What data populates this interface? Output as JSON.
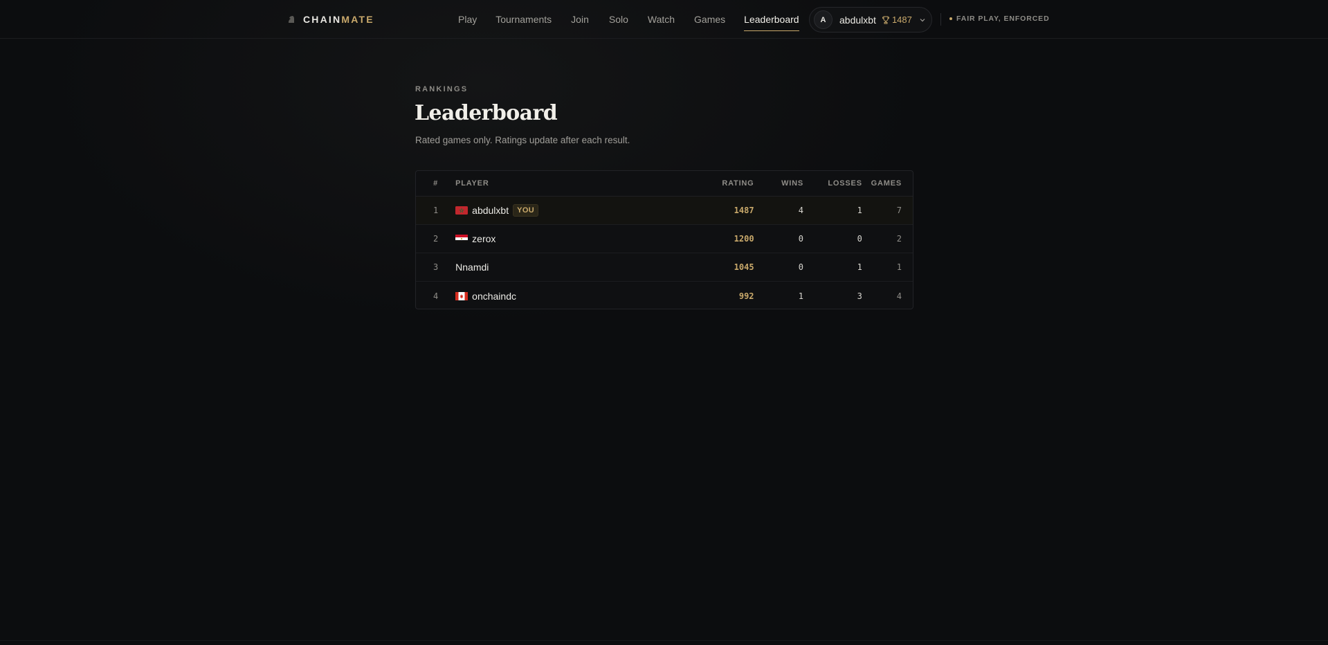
{
  "brand": {
    "part1": "CHAIN",
    "part2": "MATE"
  },
  "nav": {
    "items": [
      {
        "label": "Play"
      },
      {
        "label": "Tournaments"
      },
      {
        "label": "Join"
      },
      {
        "label": "Solo"
      },
      {
        "label": "Watch"
      },
      {
        "label": "Games"
      },
      {
        "label": "Leaderboard",
        "active": true
      }
    ]
  },
  "user": {
    "avatar_initial": "A",
    "name": "abdulxbt",
    "rating": "1487"
  },
  "fairplay": {
    "label": "FAIR PLAY, ENFORCED"
  },
  "page": {
    "eyebrow": "RANKINGS",
    "title": "Leaderboard",
    "subtitle": "Rated games only. Ratings update after each result."
  },
  "table": {
    "headers": {
      "rank": "#",
      "player": "PLAYER",
      "rating": "RATING",
      "wins": "WINS",
      "losses": "LOSSES",
      "games": "GAMES"
    },
    "rows": [
      {
        "rank": "1",
        "player": "abdulxbt",
        "flag": "morocco-flag",
        "badge": "YOU",
        "rating": "1487",
        "wins": "4",
        "losses": "1",
        "games": "7"
      },
      {
        "rank": "2",
        "player": "zerox",
        "flag": "egypt-flag",
        "rating": "1200",
        "wins": "0",
        "losses": "0",
        "games": "2"
      },
      {
        "rank": "3",
        "player": "Nnamdi",
        "flag": "",
        "rating": "1045",
        "wins": "0",
        "losses": "1",
        "games": "1"
      },
      {
        "rank": "4",
        "player": "onchaindc",
        "flag": "canada-flag",
        "rating": "992",
        "wins": "1",
        "losses": "3",
        "games": "4"
      }
    ]
  },
  "colors": {
    "accent": "#c9a96b",
    "background": "#0c0d0f"
  }
}
